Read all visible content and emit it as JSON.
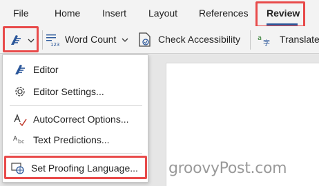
{
  "tabs": [
    "File",
    "Home",
    "Insert",
    "Layout",
    "References",
    "Review"
  ],
  "toolbar": {
    "word_count": "Word Count",
    "check_accessibility": "Check Accessibility",
    "translate": "Translate"
  },
  "menu": {
    "items": [
      "Editor",
      "Editor Settings...",
      "AutoCorrect Options...",
      "Text Predictions...",
      "Set Proofing Language..."
    ]
  },
  "icons": {
    "editor": "editor-pen-icon",
    "settings": "gear-icon",
    "autocorrect": "autocorrect-icon",
    "text_predictions": "abc-icon",
    "proofing_language": "language-globe-icon",
    "word_count": "word-count-icon",
    "accessibility": "accessibility-check-icon",
    "translate": "translate-icon"
  },
  "colors": {
    "highlight": "#e84a4a",
    "accent": "#2b579a"
  },
  "watermark": "groovyPost.com"
}
